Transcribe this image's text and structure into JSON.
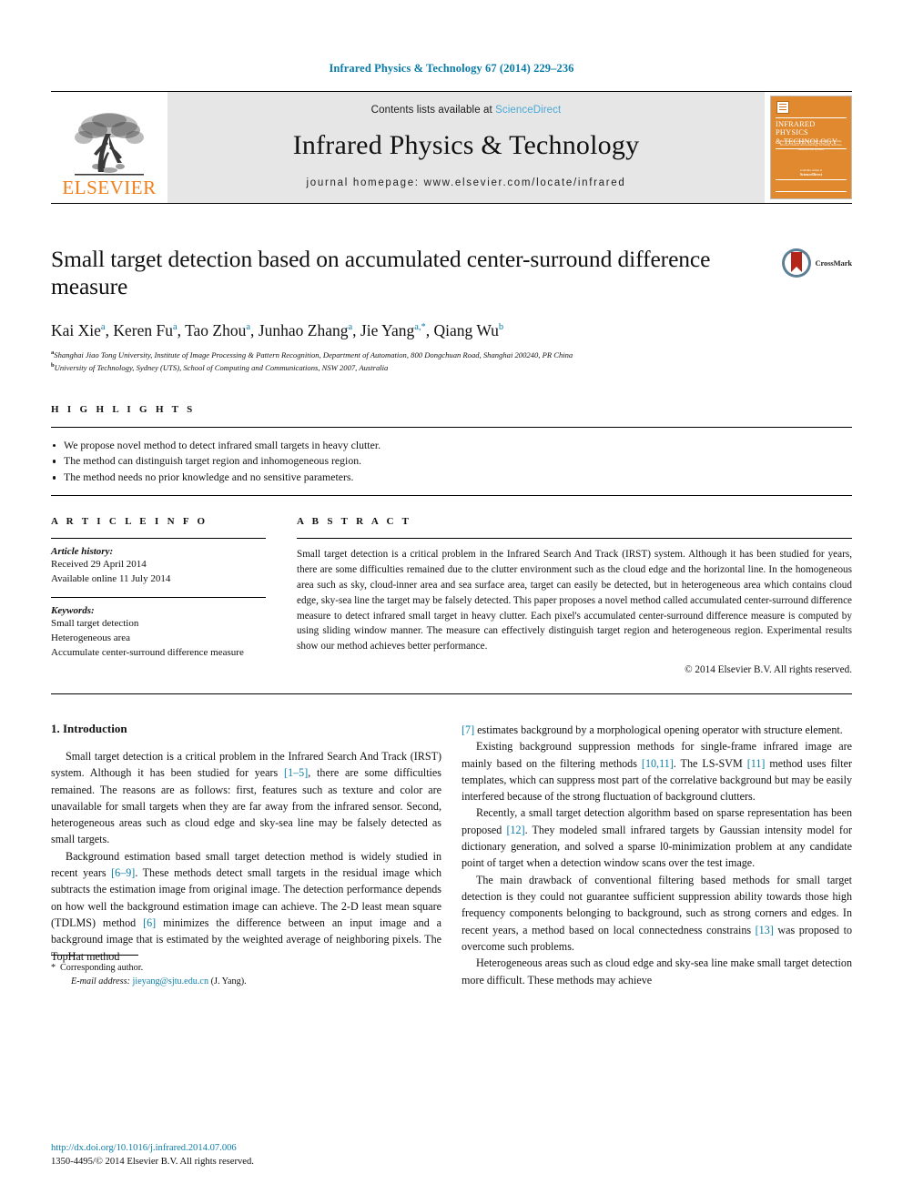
{
  "journal_ref": "Infrared Physics & Technology 67 (2014) 229–236",
  "masthead": {
    "publisher_wordmark": "ELSEVIER",
    "contents_prefix": "Contents lists available at ",
    "sciencedirect": "ScienceDirect",
    "journal_title": "Infrared Physics & Technology",
    "homepage": "journal homepage: www.elsevier.com/locate/infrared",
    "cover": {
      "title_line1": "INFRARED PHYSICS",
      "title_line2": "& TECHNOLOGY",
      "subtitle": "An international journal devoted to all aspects of the infrared sciences and technology, including detectors, materials and systems",
      "foot_small": "available online at",
      "foot_brand": "ScienceDirect"
    },
    "colors": {
      "link_blue": "#4aa8d8",
      "elsevier_orange": "#f07f1a",
      "cover_orange": "#e0892e",
      "banner_gray": "#e6e6e6"
    }
  },
  "article": {
    "title": "Small target detection based on accumulated center-surround difference measure",
    "crossmark_label": "CrossMark",
    "authors": [
      {
        "name": "Kai Xie",
        "marks": "a"
      },
      {
        "name": "Keren Fu",
        "marks": "a"
      },
      {
        "name": "Tao Zhou",
        "marks": "a"
      },
      {
        "name": "Junhao Zhang",
        "marks": "a"
      },
      {
        "name": "Jie Yang",
        "marks": "a,*"
      },
      {
        "name": "Qiang Wu",
        "marks": "b"
      }
    ],
    "affiliations": [
      {
        "mark": "a",
        "text": "Shanghai Jiao Tong University, Institute of Image Processing & Pattern Recognition, Department of Automation, 800 Dongchuan Road, Shanghai 200240, PR China"
      },
      {
        "mark": "b",
        "text": "University of Technology, Sydney (UTS), School of Computing and Communications, NSW 2007, Australia"
      }
    ]
  },
  "highlights": {
    "label": "H I G H L I G H T S",
    "items": [
      "We propose novel method to detect infrared small targets in heavy clutter.",
      "The method can distinguish target region and inhomogeneous region.",
      "The method needs no prior knowledge and no sensitive parameters."
    ]
  },
  "article_info": {
    "label": "A R T I C L E    I N F O",
    "history_heading": "Article history:",
    "history_lines": [
      "Received 29 April 2014",
      "Available online 11 July 2014"
    ],
    "keywords_heading": "Keywords:",
    "keywords": [
      "Small target detection",
      "Heterogeneous area",
      "Accumulate center-surround difference measure"
    ]
  },
  "abstract": {
    "label": "A B S T R A C T",
    "text": "Small target detection is a critical problem in the Infrared Search And Track (IRST) system. Although it has been studied for years, there are some difficulties remained due to the clutter environment such as the cloud edge and the horizontal line. In the homogeneous area such as sky, cloud-inner area and sea surface area, target can easily be detected, but in heterogeneous area which contains cloud edge, sky-sea line the target may be falsely detected. This paper proposes a novel method called accumulated center-surround difference measure to detect infrared small target in heavy clutter. Each pixel's accumulated center-surround difference measure is computed by using sliding window manner. The measure can effectively distinguish target region and heterogeneous region. Experimental results show our method achieves better performance.",
    "copyright": "© 2014 Elsevier B.V. All rights reserved."
  },
  "introduction": {
    "heading": "1. Introduction",
    "left_paragraphs": [
      {
        "segments": [
          {
            "t": "Small target detection is a critical problem in the Infrared Search And Track (IRST) system. Although it has been studied for years "
          },
          {
            "t": "[1–5]",
            "link": true
          },
          {
            "t": ", there are some difficulties remained. The reasons are as follows: first, features such as texture and color are unavailable for small targets when they are far away from the infrared sensor. Second, heterogeneous areas such as cloud edge and sky-sea line may be falsely detected as small targets."
          }
        ]
      },
      {
        "segments": [
          {
            "t": "Background estimation based small target detection method is widely studied in recent years "
          },
          {
            "t": "[6–9]",
            "link": true
          },
          {
            "t": ". These methods detect small targets in the residual image which subtracts the estimation image from original image. The detection performance depends on how well the background estimation image can achieve. The 2-D least mean square (TDLMS) method "
          },
          {
            "t": "[6]",
            "link": true
          },
          {
            "t": " minimizes the difference between an input image and a background image that is estimated by the weighted average of neighboring pixels. The TopHat method"
          }
        ]
      }
    ],
    "right_paragraphs": [
      {
        "segments": [
          {
            "t": "[7]",
            "link": true
          },
          {
            "t": " estimates background by a morphological opening operator with structure element."
          }
        ],
        "no_indent": true
      },
      {
        "segments": [
          {
            "t": "Existing background suppression methods for single-frame infrared image are mainly based on the filtering methods "
          },
          {
            "t": "[10,11]",
            "link": true
          },
          {
            "t": ". The LS-SVM "
          },
          {
            "t": "[11]",
            "link": true
          },
          {
            "t": " method uses filter templates, which can suppress most part of the correlative background but may be easily interfered because of the strong fluctuation of background clutters."
          }
        ]
      },
      {
        "segments": [
          {
            "t": "Recently, a small target detection algorithm based on sparse representation has been proposed "
          },
          {
            "t": "[12]",
            "link": true
          },
          {
            "t": ". They modeled small infrared targets by Gaussian intensity model for dictionary generation, and solved a sparse l0-minimization problem at any candidate point of target when a detection window scans over the test image."
          }
        ]
      },
      {
        "segments": [
          {
            "t": "The main drawback of conventional filtering based methods for small target detection is they could not guarantee sufficient suppression ability towards those high frequency components belonging to background, such as strong corners and edges. In recent years, a method based on local connectedness constrains "
          },
          {
            "t": "[13]",
            "link": true
          },
          {
            "t": " was proposed to overcome such problems."
          }
        ]
      },
      {
        "segments": [
          {
            "t": "Heterogeneous areas such as cloud edge and sky-sea line make small target detection more difficult. These methods may achieve"
          }
        ]
      }
    ]
  },
  "footnote": {
    "star": "*",
    "corresponding": "Corresponding author.",
    "email_label": "E-mail address:",
    "email": "jieyang@sjtu.edu.cn",
    "email_suffix": "(J. Yang)."
  },
  "footer": {
    "doi": "http://dx.doi.org/10.1016/j.infrared.2014.07.006",
    "issn": "1350-4495/© 2014 Elsevier B.V. All rights reserved."
  }
}
